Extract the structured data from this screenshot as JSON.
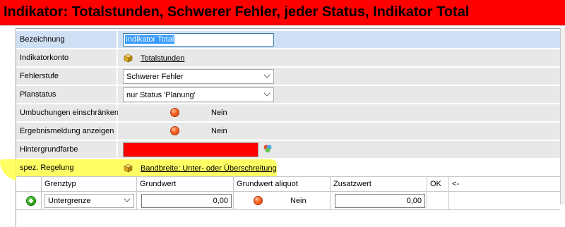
{
  "window": {
    "title": "Indikator: Totalstunden, Schwerer Fehler, jeder Status, Indikator Total"
  },
  "form": {
    "bezeichnung": {
      "label": "Bezeichnung",
      "value": "Indikator Total"
    },
    "indikatorkonto": {
      "label": "Indikatorkonto",
      "value": "Totalstunden",
      "icon": "cube-icon"
    },
    "fehlerstufe": {
      "label": "Fehlerstufe",
      "value": "Schwerer Fehler"
    },
    "planstatus": {
      "label": "Planstatus",
      "value": "nur Status 'Planung'"
    },
    "umbuchungen": {
      "label": "Umbuchungen einschränken",
      "value": "Nein"
    },
    "ergebnismeldung": {
      "label": "Ergebnismeldung anzeigen",
      "value": "Nein"
    },
    "hintergrundfarbe": {
      "label": "Hintergrundfarbe",
      "color": "#ff0000"
    },
    "spez_regelung": {
      "label": "spez. Regelung",
      "value": "Bandbreite: Unter- oder Überschreitung",
      "icon": "cube-icon"
    }
  },
  "grid": {
    "columns": [
      "Grenztyp",
      "Grundwert",
      "Grundwert aliquot",
      "Zusatzwert",
      "OK",
      "<-"
    ],
    "rows": [
      {
        "grenztyp": "Untergrenze",
        "grundwert": "0,00",
        "aliquot": "Nein",
        "zusatzwert": "0,00"
      }
    ]
  },
  "colors": {
    "title_bg": "#ff0000",
    "row_bg": "#e8e8e8",
    "selected_bg": "#cfe0f4",
    "highlight": "#ffff4a"
  }
}
